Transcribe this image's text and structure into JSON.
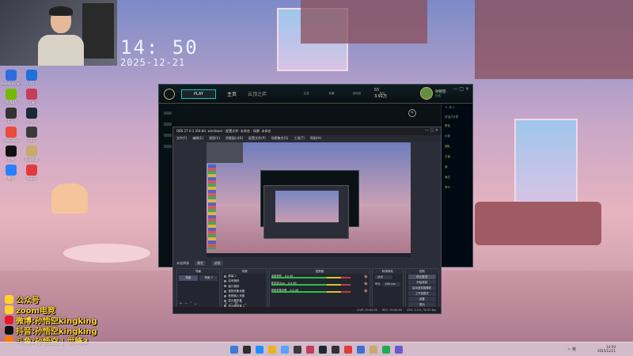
{
  "wallpaper": {
    "clock_time": "14: 50",
    "clock_date": "2025-12-21"
  },
  "webcam": {
    "label": "streamer webcam"
  },
  "desktop_icons": [
    {
      "label": "Windows 安全",
      "color": "#2d6cdf"
    },
    {
      "label": "QQ",
      "color": "#1e6fd9"
    },
    {
      "label": "NVIDIA",
      "color": "#76b900"
    },
    {
      "label": "王者",
      "color": "#c83b5a"
    },
    {
      "label": "Epic",
      "color": "#333333"
    },
    {
      "label": "Steam",
      "color": "#1b2838"
    },
    {
      "label": "WeGame",
      "color": "#e94b3c"
    },
    {
      "label": "OBS",
      "color": "#3a3a3a"
    },
    {
      "label": "剪映",
      "color": "#111111"
    },
    {
      "label": "英雄联盟",
      "color": "#c8aa6e"
    },
    {
      "label": "雷电",
      "color": "#2b80ff"
    },
    {
      "label": "网易云",
      "color": "#e23b3b"
    }
  ],
  "social": [
    {
      "platform": "公众号",
      "name": "",
      "color": "#ffd22e"
    },
    {
      "platform": "zoom电竞",
      "name": "",
      "color": "#ffd22e"
    },
    {
      "platform": "微博:",
      "name": "孙悟空kingking",
      "color": "#e6162d"
    },
    {
      "platform": "抖音:",
      "name": "孙悟空kingking",
      "color": "#111111"
    },
    {
      "platform": "斗鱼:",
      "name": "孙悟空 | 世峰3",
      "color": "#ff7a00"
    }
  ],
  "lol": {
    "play_label": "PLAY",
    "nav": [
      "主页",
      "云顶之弈"
    ],
    "mini_nav": [
      "生涯",
      "收藏",
      "战利品",
      "商店"
    ],
    "blue_essence": "65",
    "riot_points": "3.91万",
    "player_name": "孙悟空-",
    "status": "在线",
    "sidebar_head": "好友/分享",
    "sidebar_items": [
      "李佳",
      "小张",
      "团队",
      "王者",
      "我",
      "海王",
      "李千"
    ],
    "window_buttons": "— □ ✕"
  },
  "obs": {
    "title": "OBS 27.0.1 (64-bit, windows) - 配置文件: 未命名 - 场景: 未命名",
    "menu": [
      "文件(F)",
      "编辑(E)",
      "视图(V)",
      "停靠窗口(D)",
      "配置文件(P)",
      "场景集合(S)",
      "工具(T)",
      "帮助(H)"
    ],
    "source_bar_label": "未选择源",
    "source_bar_btns": [
      "属性",
      "滤镜"
    ],
    "docks": {
      "scenes": "场景",
      "sources": "来源",
      "mixer": "混音器",
      "transitions": "转场特效",
      "controls": "控制"
    },
    "scenes": [
      "场景",
      "场景 2"
    ],
    "sources": [
      "屏幕 2",
      "游戏捕获",
      "窗口捕获",
      "视频采集设备",
      "音频输入采集",
      "显示器采集",
      "显示器采集 2"
    ],
    "mixer": [
      {
        "name": "桌面音频",
        "level": "0.0 dB"
      },
      {
        "name": "麦克风/Aux",
        "level": "0.0 dB"
      },
      {
        "name": "视频采集设备",
        "level": "0.0 dB"
      }
    ],
    "transition": {
      "type": "淡出",
      "duration_label": "时长",
      "duration": "300 ms"
    },
    "controls": [
      "停止推流",
      "开始录制",
      "启动虚拟摄像机",
      "工作室模式",
      "设置",
      "退出"
    ],
    "status": [
      "LIVE: 00:00:00",
      "REC: 00:00:00",
      "CPU: 2.1%, 30.00 fps"
    ]
  },
  "taskbar": {
    "time": "14:50",
    "date": "2025/12/21",
    "tray": "ㅅ  英  ",
    "icons": [
      "#3a7bd5",
      "#2d2d2d",
      "#1f8fff",
      "#e6b422",
      "#5aa0ff",
      "#3a3a3a",
      "#c83b5a",
      "#1b2838",
      "#333333",
      "#e23b3b",
      "#3f6fd0",
      "#c8aa6e",
      "#22aa55",
      "#6a5acd"
    ]
  }
}
